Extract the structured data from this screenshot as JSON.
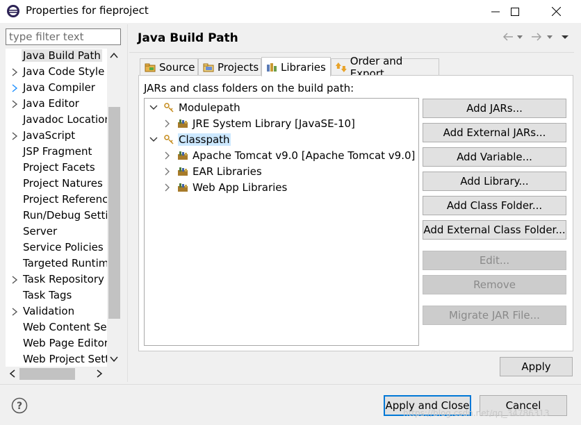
{
  "window": {
    "title": "Properties for fieproject",
    "app_icon": "eclipse-icon",
    "controls": [
      "minimize-icon",
      "maximize-icon",
      "close-icon"
    ]
  },
  "filter": {
    "placeholder": "type filter text",
    "value": ""
  },
  "nav": {
    "items": [
      {
        "label": "Java Build Path",
        "expandable": false,
        "selected": true
      },
      {
        "label": "Java Code Style",
        "expandable": true
      },
      {
        "label": "Java Compiler",
        "expandable": true,
        "accent": true
      },
      {
        "label": "Java Editor",
        "expandable": true
      },
      {
        "label": "Javadoc Location",
        "expandable": false
      },
      {
        "label": "JavaScript",
        "expandable": true
      },
      {
        "label": "JSP Fragment",
        "expandable": false
      },
      {
        "label": "Project Facets",
        "expandable": false
      },
      {
        "label": "Project Natures",
        "expandable": false
      },
      {
        "label": "Project References",
        "expandable": false
      },
      {
        "label": "Run/Debug Settings",
        "expandable": false
      },
      {
        "label": "Server",
        "expandable": false
      },
      {
        "label": "Service Policies",
        "expandable": false
      },
      {
        "label": "Targeted Runtimes",
        "expandable": false
      },
      {
        "label": "Task Repository",
        "expandable": true
      },
      {
        "label": "Task Tags",
        "expandable": false
      },
      {
        "label": "Validation",
        "expandable": true
      },
      {
        "label": "Web Content Settings",
        "expandable": false
      },
      {
        "label": "Web Page Editor",
        "expandable": false
      },
      {
        "label": "Web Project Settings",
        "expandable": false
      }
    ]
  },
  "page": {
    "title": "Java Build Path",
    "nav_icons": [
      "back-arrow-icon",
      "chevron-down-icon",
      "forward-arrow-icon",
      "chevron-down-icon",
      "view-menu-icon"
    ]
  },
  "tabs": [
    {
      "label": "Source",
      "icon": "source-folder-icon",
      "active": false
    },
    {
      "label": "Projects",
      "icon": "projects-icon",
      "active": false
    },
    {
      "label": "Libraries",
      "icon": "libraries-icon",
      "active": true
    },
    {
      "label": "Order and Export",
      "icon": "order-export-icon",
      "active": false
    }
  ],
  "libraries": {
    "section_label": "JARs and class folders on the build path:",
    "tree": [
      {
        "label": "Modulepath",
        "level": 0,
        "expanded": true,
        "icon": "modulepath-icon"
      },
      {
        "label": "JRE System Library [JavaSE-10]",
        "level": 1,
        "expanded": false,
        "icon": "library-jar-icon"
      },
      {
        "label": "Classpath",
        "level": 0,
        "expanded": true,
        "icon": "classpath-icon",
        "selected": true
      },
      {
        "label": "Apache Tomcat v9.0 [Apache Tomcat v9.0]",
        "level": 1,
        "expanded": false,
        "icon": "library-jar-icon"
      },
      {
        "label": "EAR Libraries",
        "level": 1,
        "expanded": false,
        "icon": "library-jar-icon"
      },
      {
        "label": "Web App Libraries",
        "level": 1,
        "expanded": false,
        "icon": "library-jar-icon"
      }
    ],
    "buttons": [
      {
        "label": "Add JARs...",
        "enabled": true
      },
      {
        "label": "Add External JARs...",
        "enabled": true
      },
      {
        "label": "Add Variable...",
        "enabled": true
      },
      {
        "label": "Add Library...",
        "enabled": true
      },
      {
        "label": "Add Class Folder...",
        "enabled": true
      },
      {
        "label": "Add External Class Folder...",
        "enabled": true
      },
      {
        "label": "Edit...",
        "enabled": false
      },
      {
        "label": "Remove",
        "enabled": false
      },
      {
        "label": "Migrate JAR File...",
        "enabled": false
      }
    ]
  },
  "actions": {
    "apply": "Apply",
    "apply_and_close": "Apply and Close",
    "cancel": "Cancel",
    "help_icon": "help-icon"
  },
  "watermark": "https://blog.csdn.net/qq_34786313",
  "colors": {
    "selection": "#cce8ff",
    "focus_border": "#0078d7",
    "accent_arrow": "#1e90ff"
  }
}
